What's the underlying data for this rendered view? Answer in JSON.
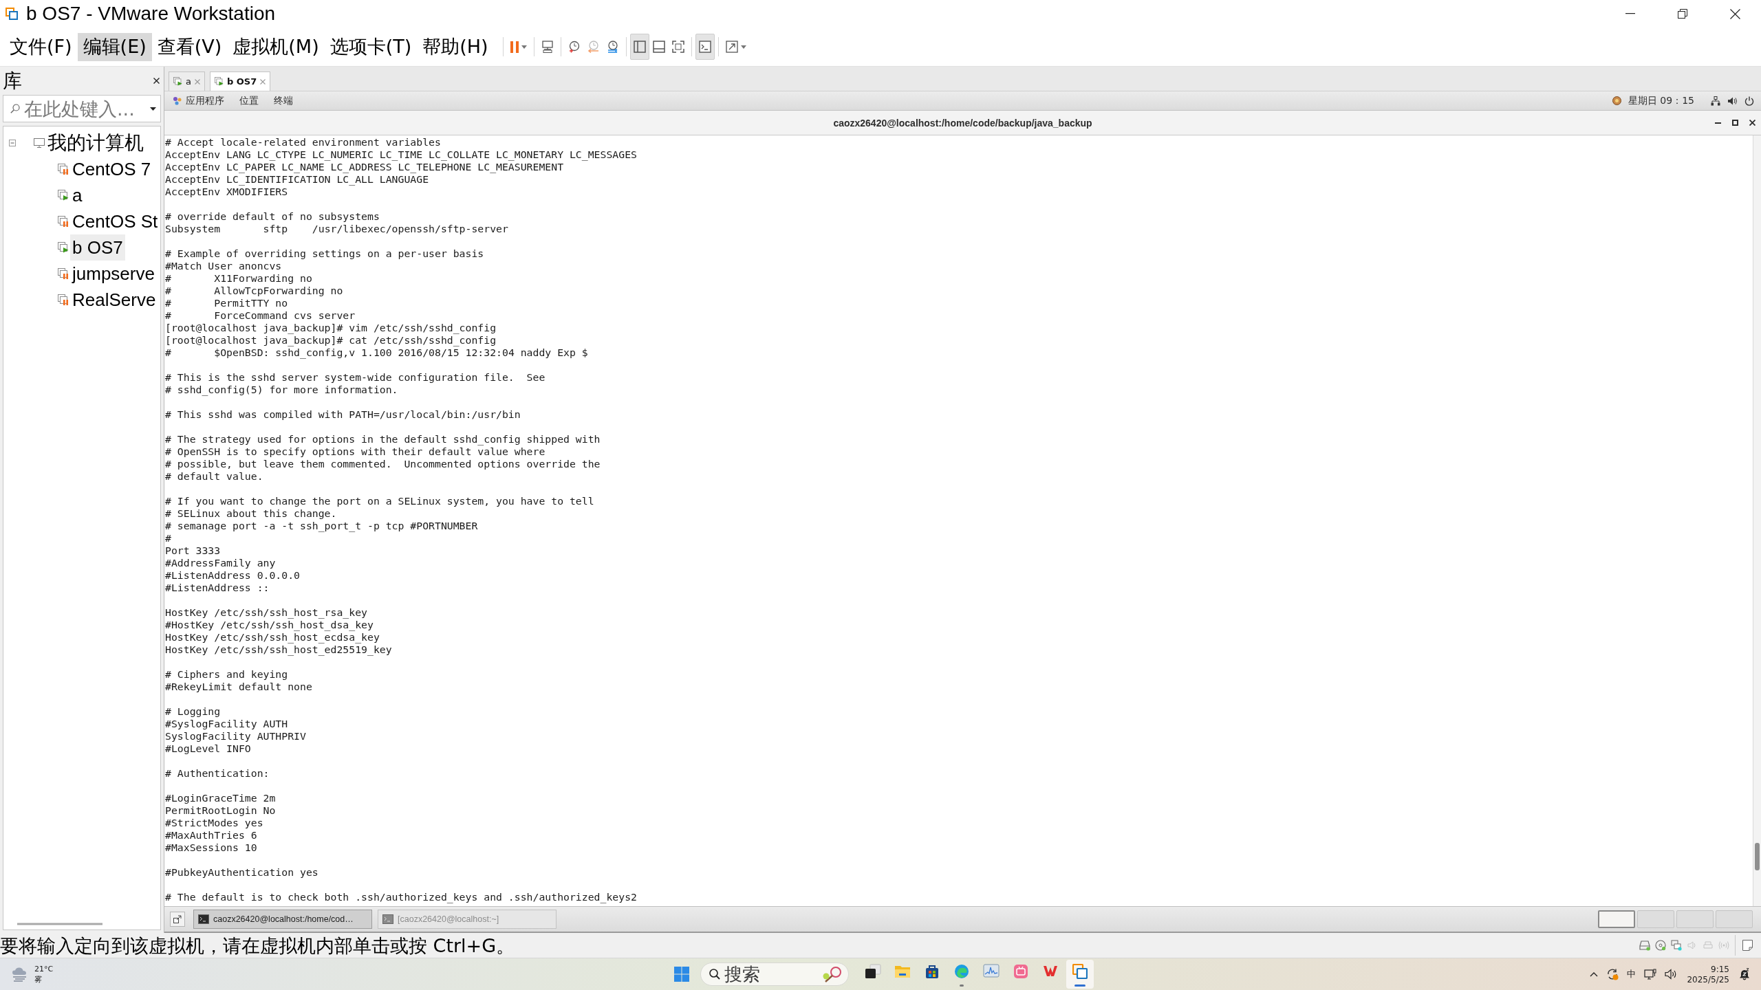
{
  "window": {
    "title": "b OS7 - VMware Workstation"
  },
  "menu": [
    {
      "label": "文件(F)",
      "highlighted": false
    },
    {
      "label": "编辑(E)",
      "highlighted": true
    },
    {
      "label": "查看(V)",
      "highlighted": false
    },
    {
      "label": "虚拟机(M)",
      "highlighted": false
    },
    {
      "label": "选项卡(T)",
      "highlighted": false
    },
    {
      "label": "帮助(H)",
      "highlighted": false
    }
  ],
  "toolbar": {
    "view_buttons": [
      {
        "pressed": true
      },
      {
        "pressed": false
      },
      {
        "pressed": false
      }
    ],
    "console_button": {
      "pressed": true
    }
  },
  "library": {
    "title": "库",
    "search": {
      "placeholder": "在此处键入..."
    },
    "tree": [
      {
        "label": "我的计算机",
        "expanded": true,
        "children": [
          {
            "label": "CentOS 7",
            "suspended": true,
            "selected": false
          },
          {
            "label": "a",
            "suspended": false,
            "selected": false
          },
          {
            "label": "CentOS St",
            "suspended": true,
            "selected": false
          },
          {
            "label": "b OS7",
            "suspended": false,
            "selected": true
          },
          {
            "label": "jumpserve",
            "suspended": true,
            "selected": false
          },
          {
            "label": "RealServe",
            "suspended": true,
            "selected": false
          }
        ]
      }
    ]
  },
  "vm_tabs": [
    {
      "label": "a",
      "selected": false
    },
    {
      "label": "b OS7",
      "selected": true
    }
  ],
  "guest": {
    "top_bar": {
      "menus": [
        "应用程序",
        "位置",
        "终端"
      ],
      "clock": "星期日 09：15"
    },
    "terminal": {
      "title": "caozx26420@localhost:/home/code/backup/java_backup",
      "blocks": [
        [
          "# Accept locale-related environment variables",
          "AcceptEnv LANG LC_CTYPE LC_NUMERIC LC_TIME LC_COLLATE LC_MONETARY LC_MESSAGES",
          "AcceptEnv LC_PAPER LC_NAME LC_ADDRESS LC_TELEPHONE LC_MEASUREMENT",
          "AcceptEnv LC_IDENTIFICATION LC_ALL LANGUAGE",
          "AcceptEnv XMODIFIERS"
        ],
        [
          "# override default of no subsystems",
          "Subsystem\tsftp\t/usr/libexec/openssh/sftp-server"
        ],
        [
          "# Example of overriding settings on a per-user basis",
          "#Match User anoncvs",
          "#\tX11Forwarding no",
          "#\tAllowTcpForwarding no",
          "#\tPermitTTY no",
          "#\tForceCommand cvs server",
          "[root@localhost java_backup]# vim /etc/ssh/sshd_config",
          "[root@localhost java_backup]# cat /etc/ssh/sshd_config",
          "#\t$OpenBSD: sshd_config,v 1.100 2016/08/15 12:32:04 naddy Exp $"
        ],
        [
          "# This is the sshd server system-wide configuration file.  See",
          "# sshd_config(5) for more information."
        ],
        [
          "# This sshd was compiled with PATH=/usr/local/bin:/usr/bin"
        ],
        [
          "# The strategy used for options in the default sshd_config shipped with",
          "# OpenSSH is to specify options with their default value where",
          "# possible, but leave them commented.  Uncommented options override the",
          "# default value."
        ],
        [
          "# If you want to change the port on a SELinux system, you have to tell",
          "# SELinux about this change.",
          "# semanage port -a -t ssh_port_t -p tcp #PORTNUMBER",
          "#",
          "Port 3333",
          "#AddressFamily any",
          "#ListenAddress 0.0.0.0",
          "#ListenAddress ::"
        ],
        [
          "HostKey /etc/ssh/ssh_host_rsa_key",
          "#HostKey /etc/ssh/ssh_host_dsa_key",
          "HostKey /etc/ssh/ssh_host_ecdsa_key",
          "HostKey /etc/ssh/ssh_host_ed25519_key"
        ],
        [
          "# Ciphers and keying",
          "#RekeyLimit default none"
        ],
        [
          "# Logging",
          "#SyslogFacility AUTH",
          "SyslogFacility AUTHPRIV",
          "#LogLevel INFO"
        ],
        [
          "# Authentication:"
        ],
        [
          "#LoginGraceTime 2m",
          "PermitRootLogin No",
          "#StrictModes yes",
          "#MaxAuthTries 6",
          "#MaxSessions 10"
        ],
        [
          "#PubkeyAuthentication yes"
        ],
        [
          "# The default is to check both .ssh/authorized_keys and .ssh/authorized_keys2"
        ]
      ]
    },
    "bottom_panel": {
      "windows": [
        {
          "label": "caozx26420@localhost:/home/cod…",
          "active": true
        },
        {
          "label": "[caozx26420@localhost:~]",
          "active": false
        }
      ],
      "workspaces": [
        {
          "selected": true
        },
        {
          "selected": false
        },
        {
          "selected": false
        },
        {
          "selected": false
        }
      ]
    }
  },
  "status_bar": {
    "message": "要将输入定向到该虚拟机，请在虚拟机内部单击或按 Ctrl+G。"
  },
  "taskbar": {
    "weather": {
      "temperature": "21°C",
      "condition": "雾"
    },
    "search": {
      "placeholder": "搜索"
    },
    "apps": [
      {
        "open": false,
        "active": false
      },
      {
        "open": false,
        "active": false
      },
      {
        "open": false,
        "active": false
      },
      {
        "open": true,
        "active": false
      },
      {
        "open": false,
        "active": false
      },
      {
        "open": false,
        "active": false
      },
      {
        "open": false,
        "active": false
      },
      {
        "open": true,
        "active": true
      }
    ],
    "tray": {
      "input_method": "中",
      "time": "9:15",
      "date": "2025/5/25"
    }
  }
}
